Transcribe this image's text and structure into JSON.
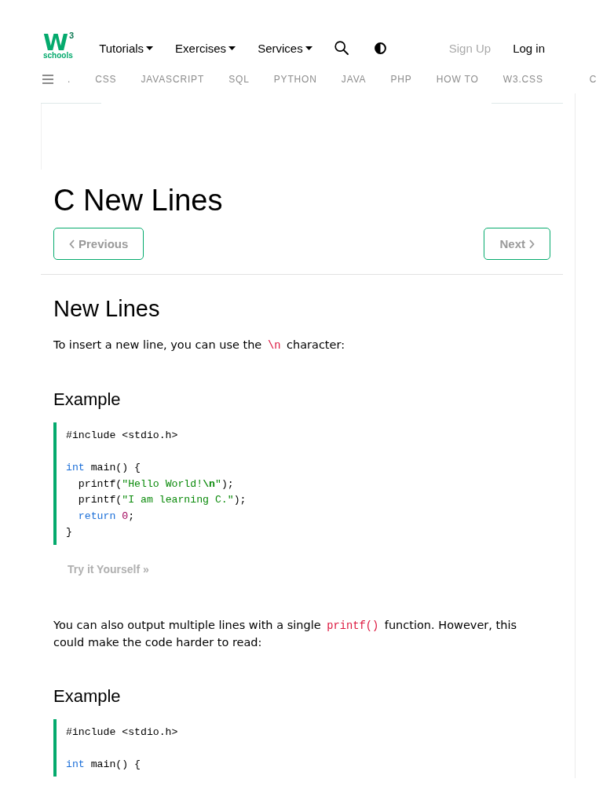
{
  "header": {
    "logo": {
      "mark": "W",
      "superscript": "3",
      "word": "schools"
    },
    "menus": [
      "Tutorials",
      "Exercises",
      "Services"
    ],
    "sign_up": "Sign Up",
    "log_in": "Log in"
  },
  "topics": [
    ".",
    "CSS",
    "JAVASCRIPT",
    "SQL",
    "PYTHON",
    "JAVA",
    "PHP",
    "HOW TO",
    "W3.CSS",
    "C"
  ],
  "title": "C New Lines",
  "pager": {
    "previous": "Previous",
    "next": "Next"
  },
  "content": [
    {
      "kind": "heading",
      "text": "New Lines"
    },
    {
      "kind": "paragraph",
      "parts": [
        {
          "kind": "text",
          "text": "To insert a new line, you can use the"
        },
        {
          "kind": "code",
          "text": "\\n"
        },
        {
          "kind": "text",
          "text": "character:"
        }
      ]
    },
    {
      "kind": "subheading",
      "text": "Example"
    },
    {
      "kind": "code",
      "lines": [
        {
          "kind": "code",
          "tokens": [
            {
              "kind": "plain",
              "text": "#include <stdio.h>"
            }
          ]
        },
        {
          "kind": "blank"
        },
        {
          "kind": "code",
          "tokens": [
            {
              "kind": "keyword",
              "text": "int"
            },
            {
              "kind": "plain",
              "text": " main() {"
            }
          ]
        },
        {
          "kind": "code",
          "tokens": [
            {
              "kind": "plain",
              "text": "  printf("
            },
            {
              "kind": "string",
              "text": "\"Hello World!**\\n**\""
            },
            {
              "kind": "plain",
              "text": ");"
            }
          ]
        },
        {
          "kind": "code",
          "tokens": [
            {
              "kind": "plain",
              "text": "  printf("
            },
            {
              "kind": "string",
              "text": "\"I am learning C.\""
            },
            {
              "kind": "plain",
              "text": ");"
            }
          ]
        },
        {
          "kind": "code",
          "tokens": [
            {
              "kind": "keyword",
              "text": "  return "
            },
            {
              "kind": "number",
              "text": "0"
            },
            {
              "kind": "plain",
              "text": ";"
            }
          ]
        },
        {
          "kind": "code",
          "tokens": [
            {
              "kind": "plain",
              "text": "}"
            }
          ]
        }
      ]
    },
    {
      "kind": "button",
      "text": "Try it Yourself »"
    },
    {
      "kind": "paragraph",
      "parts": [
        {
          "kind": "text",
          "text": "You can also output multiple lines with a single"
        },
        {
          "kind": "code",
          "text": "printf()"
        },
        {
          "kind": "text",
          "text": "function. However, this could make the code harder to read:"
        }
      ]
    },
    {
      "kind": "subheading",
      "text": "Example"
    },
    {
      "kind": "code",
      "lines": [
        {
          "kind": "code",
          "tokens": [
            {
              "kind": "plain",
              "text": "#include <stdio.h>"
            }
          ]
        },
        {
          "kind": "blank"
        },
        {
          "kind": "code",
          "tokens": [
            {
              "kind": "keyword",
              "text": "int"
            },
            {
              "kind": "plain",
              "text": " main() {"
            }
          ]
        }
      ]
    }
  ]
}
